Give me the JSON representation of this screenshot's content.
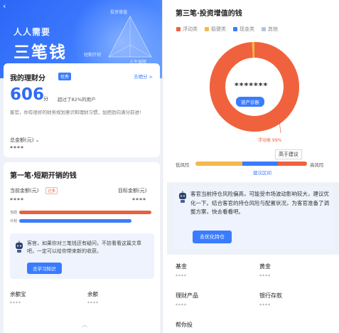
{
  "left": {
    "hero": {
      "line1": "人人需要",
      "line2": "三笔钱",
      "tag_top": "投资增值",
      "tag_left": "短期开销",
      "tag_right": "人生保障"
    },
    "score_card": {
      "title": "我的理财分",
      "badge": "优秀",
      "link": "去晒分 >",
      "score": "606",
      "unit": "分",
      "beat_text": "超过了82%的用户",
      "desc": "客官，你有很好的财务规划意识和理财习惯，加把劲向满分前进!",
      "total_label": "总金额(元) ⌄",
      "total_value": "****"
    },
    "short_card": {
      "title": "第一笔·短期开销的钱",
      "current_label": "当前金额(元)",
      "warn_badge": "过多",
      "target_label": "目标金额(元)",
      "current_value": "****",
      "target_value": "****",
      "bar_current_label": "当前",
      "bar_plan_label": "计划",
      "bar_current_fraction": 1.0,
      "bar_plan_fraction": 0.85,
      "tip_text": "客官，如果你对三笔钱还有疑问，不妨看看这篇文章吧，一定可以给你带来新的收获。",
      "tip_button": "去学习知识",
      "item1_label": "余额宝",
      "item1_value": "****",
      "item2_label": "余额",
      "item2_value": "****"
    }
  },
  "right": {
    "title": "第三笔·投资增值的钱",
    "legend": [
      {
        "label": "浮动类",
        "color": "#f0623e"
      },
      {
        "label": "稳健类",
        "color": "#f5b84a"
      },
      {
        "label": "现金类",
        "color": "#3a7cff"
      },
      {
        "label": "其他",
        "color": "#b8c4d6"
      }
    ],
    "masked_amount": "*******",
    "diagnose_button": "资产诊断",
    "float_percent_label": "浮动类 99%",
    "float_fraction": 0.99,
    "advice_label": "高于建议",
    "low_risk": "低风险",
    "high_risk": "高风险",
    "advice_zone": "建议区间",
    "tip_text": "客官当前持仓风险偏高，可能受市场波动影响较大，建议优化一下。结合客官的持仓风险与配置状况，为客官准备了调整方案，快去看看吧。",
    "tip_button": "去优化持仓",
    "items": [
      {
        "label": "基金",
        "value": "****"
      },
      {
        "label": "黄金",
        "value": "****"
      },
      {
        "label": "理财产品",
        "value": "****"
      },
      {
        "label": "银行存款",
        "value": "****"
      },
      {
        "label": "帮你投",
        "value": ""
      }
    ]
  }
}
